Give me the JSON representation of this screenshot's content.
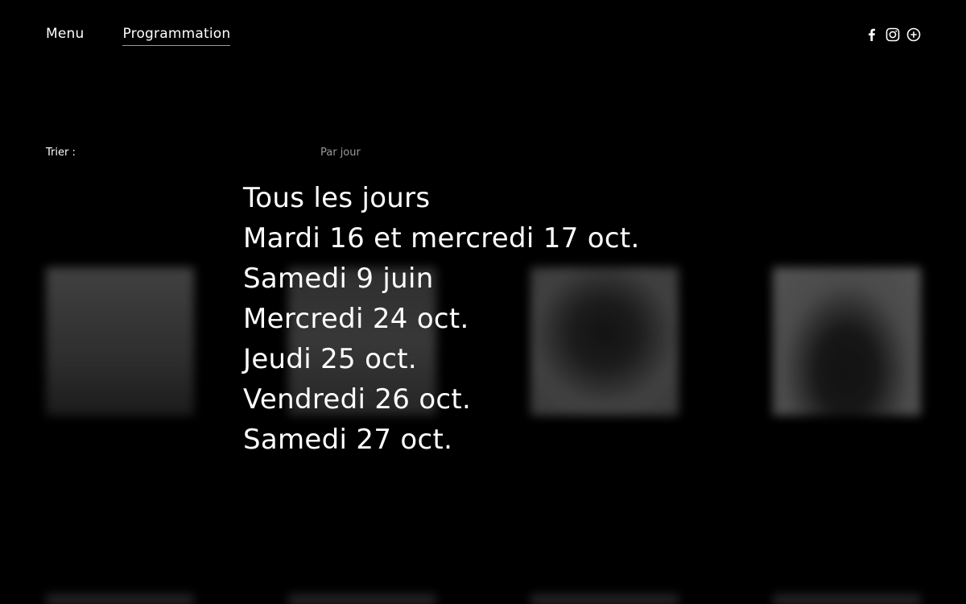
{
  "nav": {
    "menu_label": "Menu",
    "program_label": "Programmation"
  },
  "social": {
    "icons": [
      "facebook-icon",
      "instagram-icon",
      "add-circle-icon"
    ]
  },
  "sort": {
    "label": "Trier :",
    "current": "Par jour"
  },
  "days": [
    "Tous les jours",
    "Mardi 16 et mercredi 17 oct.",
    "Samedi 9 juin",
    "Mercredi 24 oct.",
    "Jeudi 25 oct.",
    "Vendredi 26 oct.",
    "Samedi 27 oct."
  ]
}
